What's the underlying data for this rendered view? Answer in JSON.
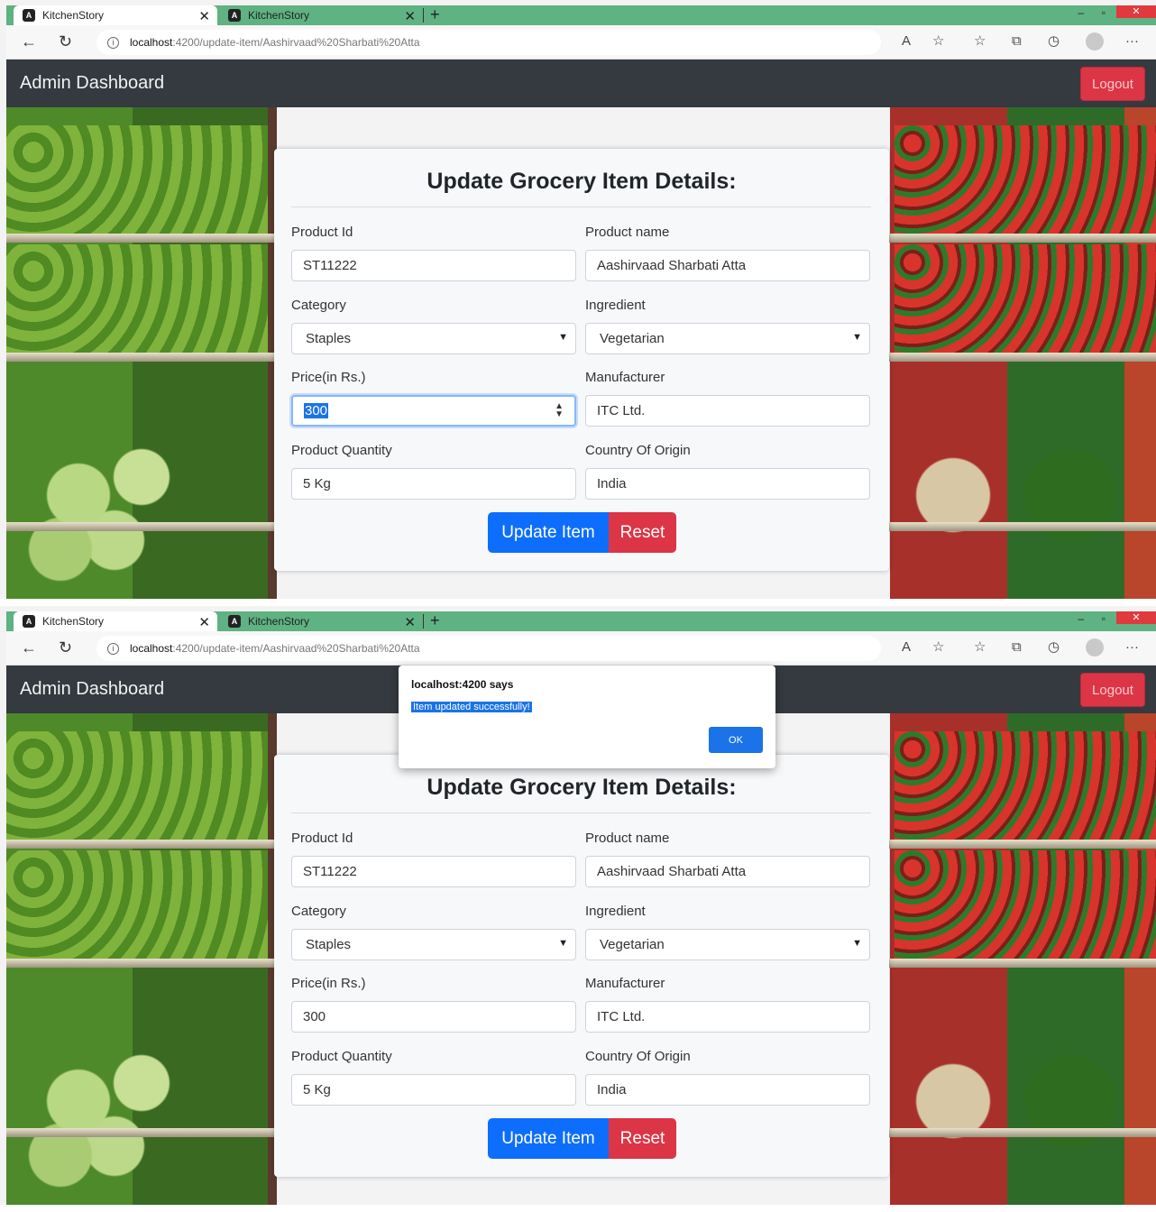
{
  "screenshots": [
    {
      "tabs": [
        {
          "label": "KitchenStory"
        },
        {
          "label": "KitchenStory"
        }
      ],
      "address": {
        "host": "localhost",
        "path": ":4200/update-item/Aashirvaad%20Sharbati%20Atta"
      },
      "navbar": {
        "brand": "Admin Dashboard",
        "logout_label": "Logout"
      },
      "form": {
        "title": "Update Grocery Item Details:",
        "product_id": {
          "label": "Product Id",
          "value": "ST11222"
        },
        "product_name": {
          "label": "Product name",
          "value": "Aashirvaad Sharbati Atta"
        },
        "category": {
          "label": "Category",
          "value": "Staples"
        },
        "ingredient": {
          "label": "Ingredient",
          "value": "Vegetarian"
        },
        "price": {
          "label": "Price(in Rs.)",
          "value": "300"
        },
        "manufacturer": {
          "label": "Manufacturer",
          "value": "ITC Ltd."
        },
        "quantity": {
          "label": "Product Quantity",
          "value": "5 Kg"
        },
        "country": {
          "label": "Country Of Origin",
          "value": "India"
        },
        "update_label": "Update Item",
        "reset_label": "Reset"
      }
    },
    {
      "tabs": [
        {
          "label": "KitchenStory"
        },
        {
          "label": "KitchenStory"
        }
      ],
      "address": {
        "host": "localhost",
        "path": ":4200/update-item/Aashirvaad%20Sharbati%20Atta"
      },
      "navbar": {
        "brand": "Admin Dashboard",
        "logout_label": "Logout"
      },
      "alert": {
        "title": "localhost:4200 says",
        "message": "Item updated successfully!",
        "ok_label": "OK"
      },
      "form": {
        "title": "Update Grocery Item Details:",
        "product_id": {
          "label": "Product Id",
          "value": "ST11222"
        },
        "product_name": {
          "label": "Product name",
          "value": "Aashirvaad Sharbati Atta"
        },
        "category": {
          "label": "Category",
          "value": "Staples"
        },
        "ingredient": {
          "label": "Ingredient",
          "value": "Vegetarian"
        },
        "price": {
          "label": "Price(in Rs.)",
          "value": "300"
        },
        "manufacturer": {
          "label": "Manufacturer",
          "value": "ITC Ltd."
        },
        "quantity": {
          "label": "Product Quantity",
          "value": "5 Kg"
        },
        "country": {
          "label": "Country Of Origin",
          "value": "India"
        },
        "update_label": "Update Item",
        "reset_label": "Reset"
      }
    }
  ],
  "icons": [
    "angular-icon",
    "close-icon",
    "plus-icon",
    "minimize-icon",
    "maximize-icon",
    "back-arrow-icon",
    "refresh-icon",
    "info-icon",
    "read-aloud-icon",
    "favorite-add-icon",
    "favorites-icon",
    "collections-icon",
    "history-icon",
    "profile-icon",
    "more-icon",
    "chevron-down-icon",
    "spinner-icon"
  ],
  "colors": {
    "navbar": "#343a40",
    "logout": "#dc3545",
    "update_button": "#0d6efd",
    "reset_button": "#dc3545",
    "tab_strip": "#5fb282",
    "alert_ok": "#1a73e8"
  }
}
